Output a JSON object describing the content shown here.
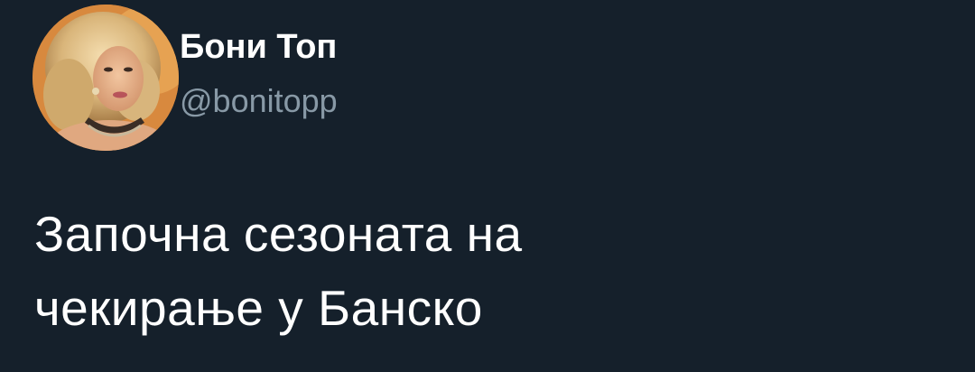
{
  "user": {
    "display_name": "Бони Топ",
    "handle": "@bonitopp",
    "avatar_icon": "profile-photo"
  },
  "tweet": {
    "lines": [
      "Започна сезоната на",
      "чекирање у Банско"
    ]
  },
  "colors": {
    "background": "#15202b",
    "primary_text": "#ffffff",
    "secondary_text": "#8899a6"
  }
}
